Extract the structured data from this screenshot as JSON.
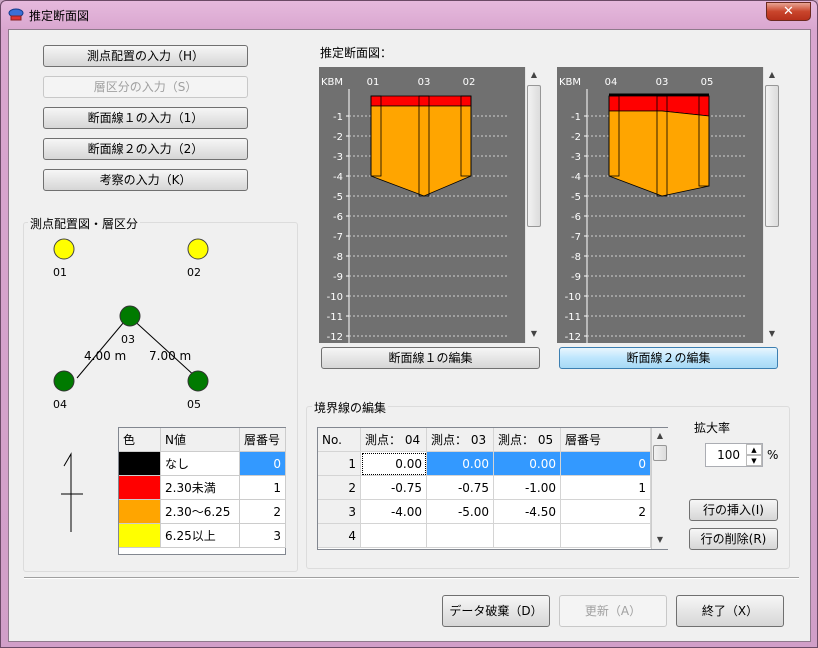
{
  "window": {
    "title": "推定断面図",
    "close": "✕"
  },
  "buttons": {
    "sokuten": "測点配置の入力（H）",
    "sou": "層区分の入力（S）",
    "dan1": "断面線１の入力（1）",
    "dan2": "断面線２の入力（2）",
    "kousatsu": "考察の入力（K）",
    "edit1": "断面線１の編集",
    "edit2": "断面線２の編集",
    "insert_row": "行の挿入(I)",
    "delete_row": "行の削除(R)",
    "discard": "データ破棄（D）",
    "update": "更新（A）",
    "finish": "終了（X）"
  },
  "sections": {
    "layout_group": "測点配置図・層区分",
    "estimate": "推定断面図：",
    "boundary": "境界線の編集",
    "zoom_label": "拡大率",
    "zoom_value": "100",
    "zoom_unit": "%"
  },
  "station_map": {
    "stations": [
      {
        "id": "01",
        "color": "#ffff00"
      },
      {
        "id": "02",
        "color": "#ffff00"
      },
      {
        "id": "03",
        "color": "#007a00"
      },
      {
        "id": "04",
        "color": "#007a00"
      },
      {
        "id": "05",
        "color": "#007a00"
      }
    ],
    "dist_04_03": "4.00 m",
    "dist_03_05": "7.00 m"
  },
  "legend": {
    "headers": [
      "色",
      "N値",
      "層番号"
    ],
    "rows": [
      {
        "color": "#000000",
        "n": "なし",
        "layer": "0"
      },
      {
        "color": "#ff0000",
        "n": "2.30未満",
        "layer": "1"
      },
      {
        "color": "#ffa500",
        "n": "2.30～6.25",
        "layer": "2"
      },
      {
        "color": "#ffff00",
        "n": "6.25以上",
        "layer": "3"
      }
    ]
  },
  "boundary_table": {
    "headers": [
      "No.",
      "測点： 04",
      "測点： 03",
      "測点： 05",
      "層番号"
    ],
    "rows": [
      [
        "1",
        "0.00",
        "0.00",
        "0.00",
        "0"
      ],
      [
        "2",
        "-0.75",
        "-0.75",
        "-1.00",
        "1"
      ],
      [
        "3",
        "-4.00",
        "-5.00",
        "-4.50",
        "2"
      ],
      [
        "4",
        "",
        "",
        "",
        ""
      ]
    ]
  },
  "chart_data": [
    {
      "type": "area",
      "name": "断面線1",
      "stations": [
        "01",
        "03",
        "02"
      ],
      "y_label": "KBM",
      "y_ticks": [
        "-1",
        "-2",
        "-3",
        "-4",
        "-5",
        "-6",
        "-7",
        "-8",
        "-9",
        "-10",
        "-11",
        "-12"
      ],
      "ylim": [
        0,
        -12
      ],
      "layers": [
        {
          "layer": 1,
          "color": "#ff0000",
          "top": [
            0,
            0,
            0
          ],
          "bottom": [
            -0.5,
            -0.5,
            -0.5
          ]
        },
        {
          "layer": 2,
          "color": "#ffa500",
          "top": [
            -0.5,
            -0.5,
            -0.5
          ],
          "bottom": [
            -4.0,
            -5.0,
            -4.0
          ]
        }
      ]
    },
    {
      "type": "area",
      "name": "断面線2",
      "stations": [
        "04",
        "03",
        "05"
      ],
      "y_label": "KBM",
      "y_ticks": [
        "-1",
        "-2",
        "-3",
        "-4",
        "-5",
        "-6",
        "-7",
        "-8",
        "-9",
        "-10",
        "-11",
        "-12"
      ],
      "ylim": [
        0,
        -12
      ],
      "layers": [
        {
          "layer": 0,
          "color": "#000000",
          "top": [
            0,
            0,
            0
          ],
          "bottom": [
            0,
            0,
            0
          ]
        },
        {
          "layer": 1,
          "color": "#ff0000",
          "top": [
            0,
            0,
            0
          ],
          "bottom": [
            -0.75,
            -0.75,
            -1.0
          ]
        },
        {
          "layer": 2,
          "color": "#ffa500",
          "top": [
            -0.75,
            -0.75,
            -1.0
          ],
          "bottom": [
            -4.0,
            -5.0,
            -4.5
          ]
        }
      ]
    }
  ]
}
